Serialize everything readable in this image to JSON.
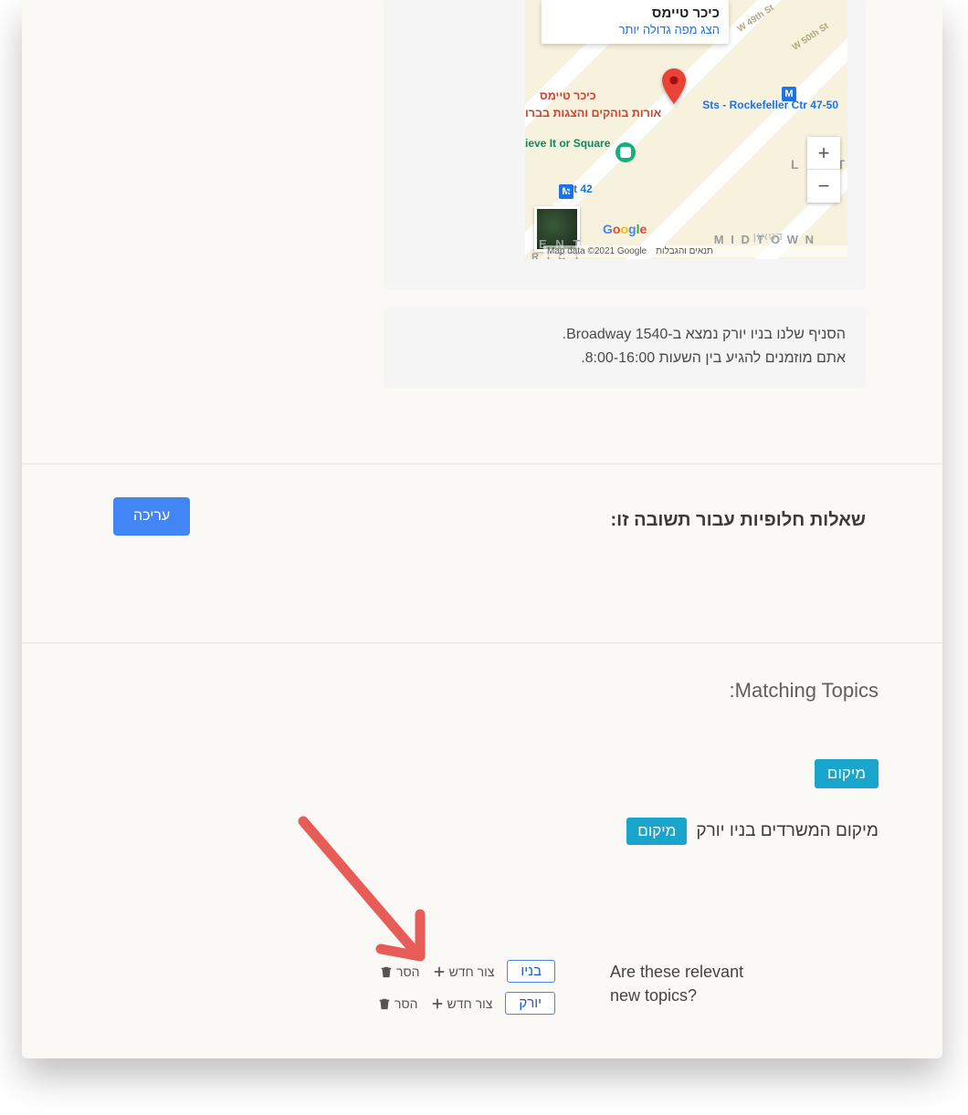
{
  "map": {
    "info_title": "כיכר טיימס",
    "info_link": "הצג מפה גדולה יותר",
    "poi_times_sq": "כיכר טיימס",
    "poi_times_sub": "אורות בוהקים והצגות בברו",
    "poi_rockefeller": "47-50 Sts - Rockefeller Ctr",
    "poi_believe": "ieve It or Square",
    "poi_42st": "42 St",
    "label_litt": "L I T T",
    "label_midtown": "M I D T O W N",
    "label_ent": "E N T",
    "label_rict": "R I C T",
    "label_he": "דטאון",
    "street1": "W 49th St",
    "street2": "W 50th St",
    "attrib_data": "Map data ©2021 Google",
    "attrib_terms": "תנאים והגבלות",
    "zoom_in": "+",
    "zoom_out": "−",
    "metro_label": "M"
  },
  "bubble": {
    "line1": "הסניף שלנו בניו יורק נמצא ב-1540 Broadway.",
    "line2": "אתם מוזמנים להגיע בין השעות 8:00-16:00."
  },
  "alt_questions": {
    "title": "שאלות חלופיות עבור תשובה זו:",
    "edit_button": "עריכה"
  },
  "matching": {
    "title": "Matching Topics:",
    "tag1": "מיקום",
    "line_text": "מיקום המשרדים בניו יורק",
    "line_tag": "מיקום"
  },
  "new_topics": {
    "prompt_line1": "Are these relevant",
    "prompt_line2": "new topics?",
    "candidates": [
      {
        "chip": "בניו",
        "create": "צור חדש",
        "remove": "הסר"
      },
      {
        "chip": "יורק",
        "create": "צור חדש",
        "remove": "הסר"
      }
    ]
  }
}
